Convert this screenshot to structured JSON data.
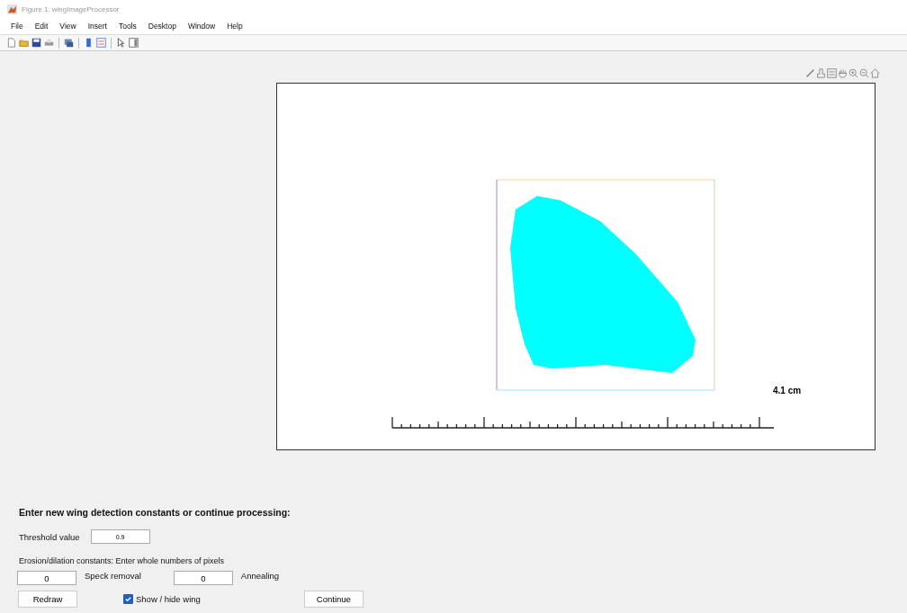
{
  "window": {
    "title": "Figure 1: wingImageProcessor"
  },
  "menu": [
    "File",
    "Edit",
    "View",
    "Insert",
    "Tools",
    "Desktop",
    "Window",
    "Help"
  ],
  "axes": {
    "scale_label": "4.1 cm"
  },
  "panel": {
    "heading": "Enter new wing detection constants or continue processing:",
    "threshold": {
      "label": "Threshold value",
      "value": "0.9"
    },
    "note": "Erosion/dilation constants: Enter whole numbers of pixels",
    "speck": {
      "value": "0",
      "label": "Speck removal"
    },
    "annealing": {
      "value": "0",
      "label": "Annealing"
    },
    "redraw_button": "Redraw",
    "show_wing": {
      "label": "Show / hide wing",
      "checked": true
    },
    "continue_button": "Continue"
  }
}
